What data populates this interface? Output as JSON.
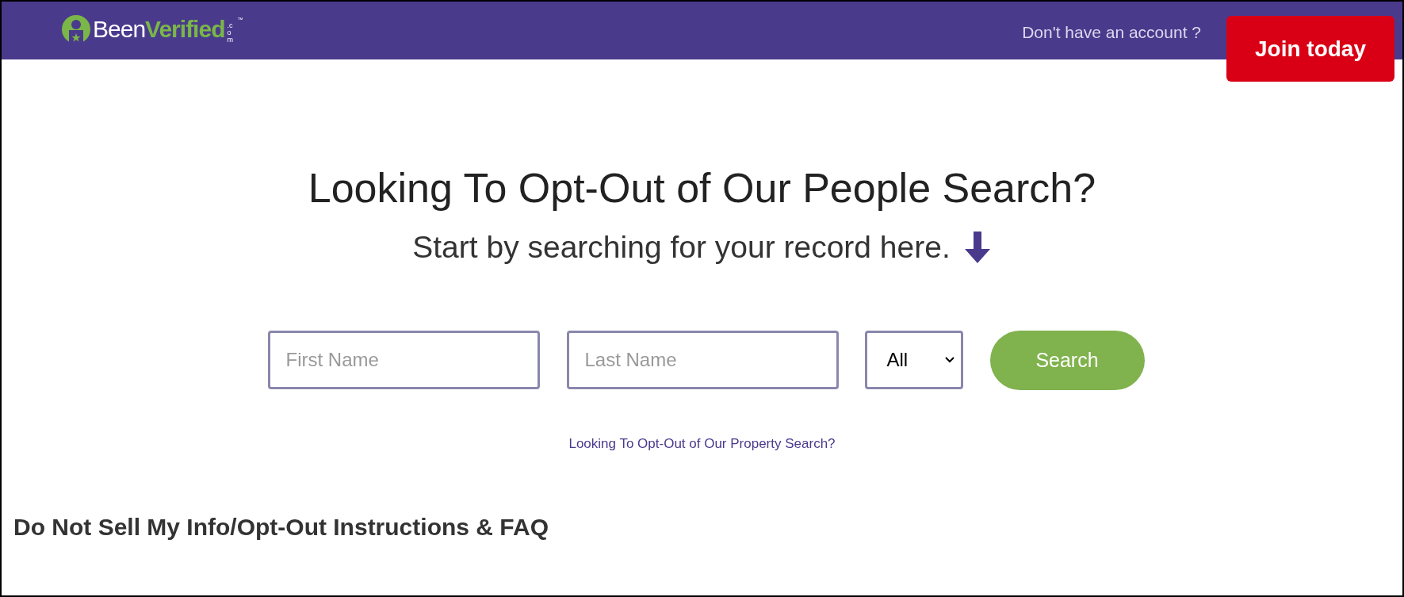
{
  "header": {
    "logo": {
      "part_1": "Been",
      "part_2": "Verified",
      "domain": ".com",
      "trademark": "™"
    },
    "account_prompt": "Don't have an account ?",
    "join_button": "Join today"
  },
  "hero": {
    "title": "Looking To Opt-Out of Our People Search?",
    "subtitle": "Start by searching for your record here."
  },
  "search_form": {
    "first_name": {
      "placeholder": "First Name"
    },
    "last_name": {
      "placeholder": "Last Name"
    },
    "state_select": {
      "value": "All"
    },
    "search_button": "Search"
  },
  "property_link": "Looking To Opt-Out of Our Property Search?",
  "faq_heading": "Do Not Sell My Info/Opt-Out Instructions & FAQ"
}
